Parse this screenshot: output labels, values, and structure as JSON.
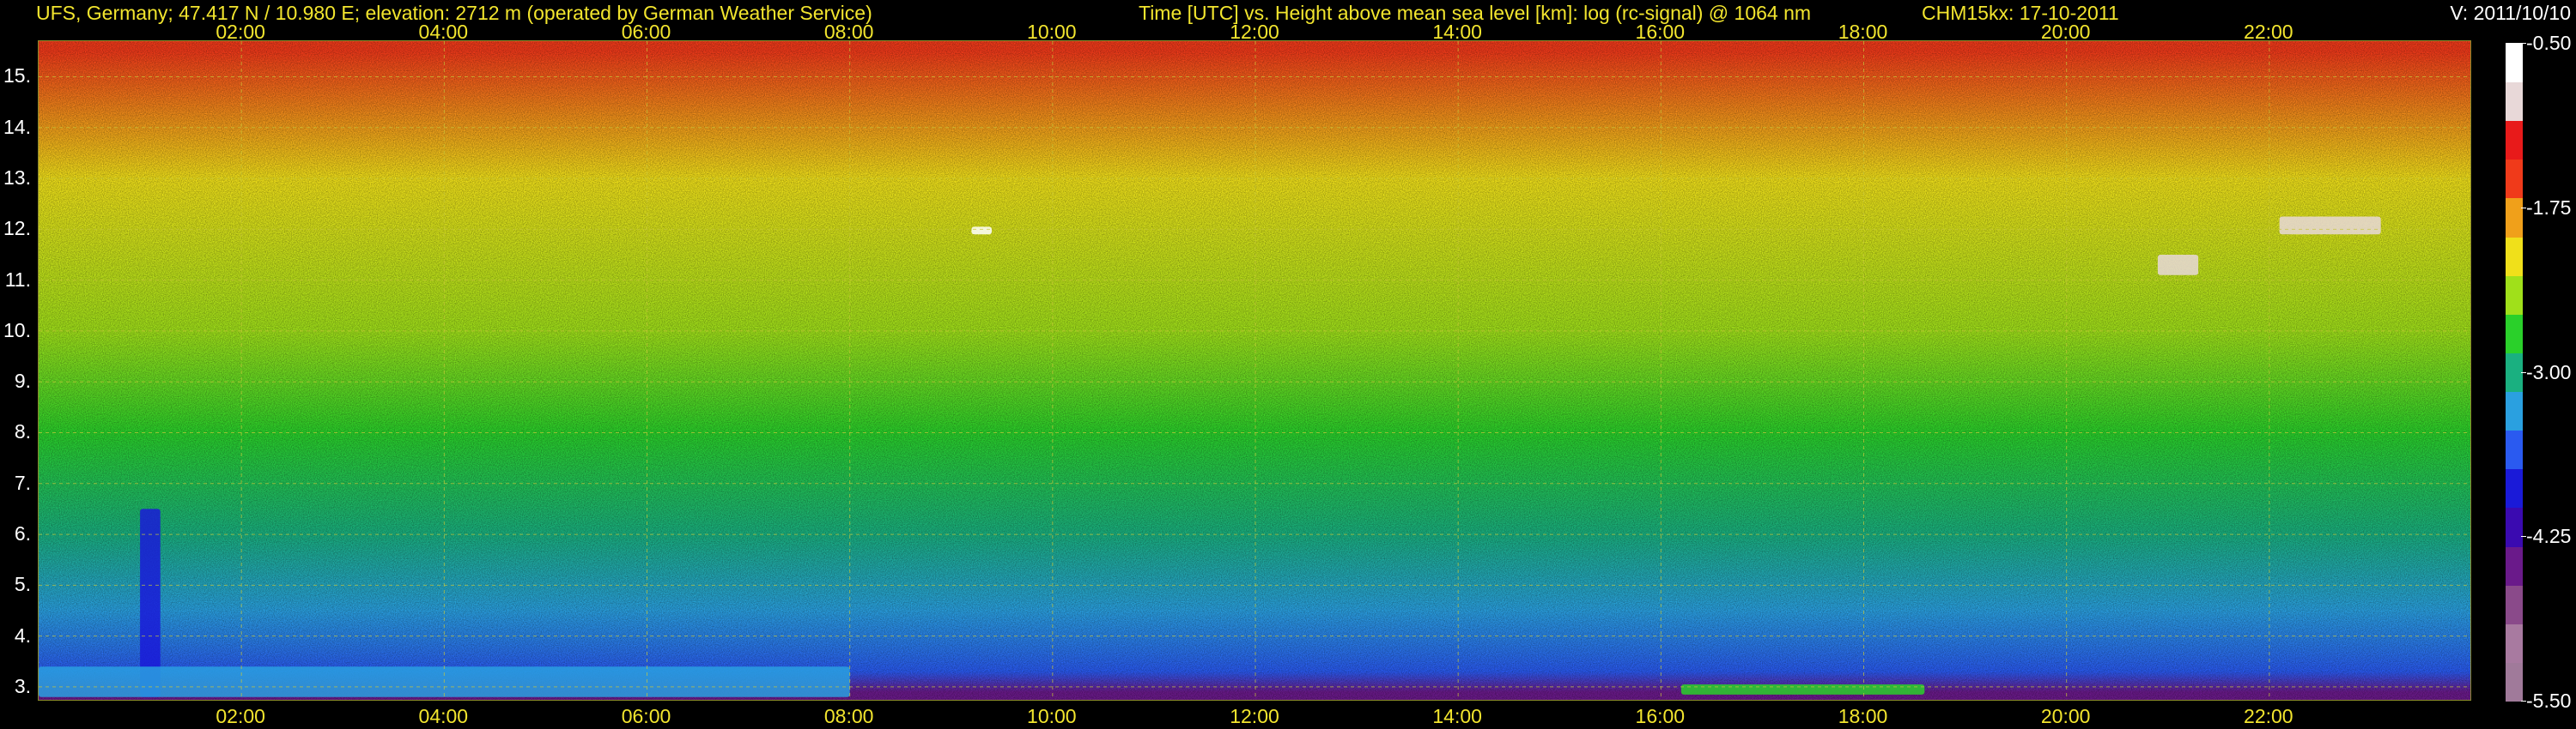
{
  "header": {
    "station": "UFS, Germany; 47.417 N / 10.980 E; elevation: 2712 m  (operated by German Weather Service)",
    "title": "Time [UTC] vs. Height above mean sea level [km]: log (rc-signal) @ 1064 nm",
    "instrument": "CHM15kx: 17-10-2011",
    "version": "V: 2011/10/10"
  },
  "chart_data": {
    "type": "heatmap",
    "title": "Time [UTC] vs. Height above mean sea level [km]: log (rc-signal) @ 1064 nm",
    "xlabel": "Time [UTC]",
    "ylabel": "Height above mean sea level [km]",
    "xlim": [
      0,
      24
    ],
    "ylim": [
      2.712,
      15.7
    ],
    "x_ticks": [
      "02:00",
      "04:00",
      "06:00",
      "08:00",
      "10:00",
      "12:00",
      "14:00",
      "16:00",
      "18:00",
      "20:00",
      "22:00"
    ],
    "y_ticks": [
      "3.",
      "4.",
      "5.",
      "6.",
      "7.",
      "8.",
      "9.",
      "10.",
      "11.",
      "12.",
      "13.",
      "14.",
      "15."
    ],
    "grid": true,
    "colorbar": {
      "label": "log (rc-signal)",
      "range": [
        -5.5,
        -0.5
      ],
      "ticks": [
        "-0.50",
        "-1.75",
        "-3.00",
        "-4.25",
        "-5.50"
      ],
      "colors": [
        "#a07a9a",
        "#a87aa0",
        "#8a4a8a",
        "#6a1a8a",
        "#3a0ab0",
        "#1a1ad8",
        "#2a5af0",
        "#2aa0e0",
        "#1ab080",
        "#2ad02a",
        "#a0e01a",
        "#f0e01a",
        "#f0a01a",
        "#f03a1a",
        "#e81a1a",
        "#e8d8d8",
        "#ffffff"
      ]
    },
    "rows": [
      {
        "height_km": 15.5,
        "start_utc": 0,
        "end_utc": 24,
        "value": -1.6
      },
      {
        "height_km": 13.0,
        "start_utc": 0,
        "end_utc": 24,
        "value": -2.0
      },
      {
        "height_km": 10.0,
        "start_utc": 0,
        "end_utc": 24,
        "value": -2.4
      },
      {
        "height_km": 8.0,
        "start_utc": 0,
        "end_utc": 24,
        "value": -2.7
      },
      {
        "height_km": 6.0,
        "start_utc": 0,
        "end_utc": 24,
        "value": -3.0
      },
      {
        "height_km": 4.5,
        "start_utc": 0,
        "end_utc": 24,
        "value": -3.3
      },
      {
        "height_km": 3.3,
        "start_utc": 0,
        "end_utc": 24,
        "value": -3.6
      },
      {
        "height_km": 2.9,
        "start_utc": 0,
        "end_utc": 24,
        "value": -4.5
      }
    ],
    "features": [
      {
        "name": "aerosol plume",
        "start_utc": 1.0,
        "end_utc": 1.2,
        "bottom_km": 2.8,
        "top_km": 6.5,
        "value": -4.0
      },
      {
        "name": "boundary layer",
        "start_utc": 0,
        "end_utc": 8.0,
        "bottom_km": 2.8,
        "top_km": 3.4,
        "value": -3.2
      },
      {
        "name": "surface layer",
        "start_utc": 16.2,
        "end_utc": 18.6,
        "bottom_km": 2.85,
        "top_km": 3.05,
        "value": -2.7
      },
      {
        "name": "cloud 1",
        "start_utc": 9.2,
        "end_utc": 9.4,
        "bottom_km": 11.9,
        "top_km": 12.05,
        "value": -0.6
      },
      {
        "name": "cloud 2",
        "start_utc": 20.9,
        "end_utc": 21.3,
        "bottom_km": 11.1,
        "top_km": 11.5,
        "value": -0.8
      },
      {
        "name": "cloud 3",
        "start_utc": 22.1,
        "end_utc": 23.1,
        "bottom_km": 11.9,
        "top_km": 12.25,
        "value": -0.8
      }
    ]
  }
}
